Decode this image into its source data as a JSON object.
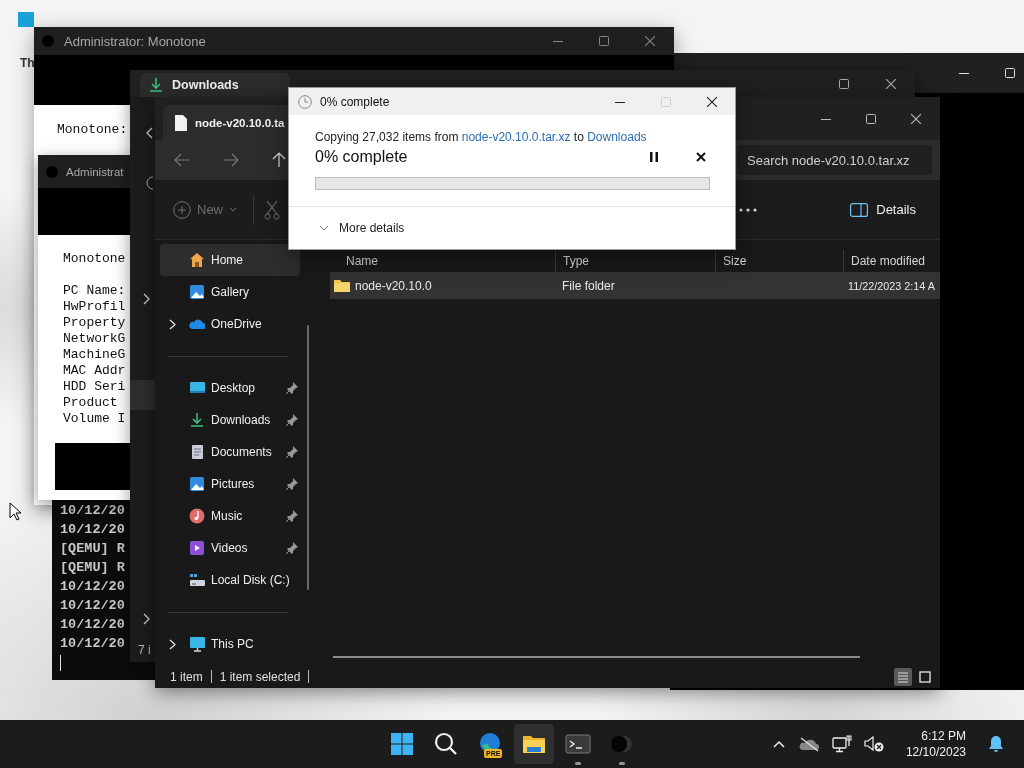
{
  "desktop": {
    "icons": [
      {
        "label": "Th"
      }
    ]
  },
  "console_main": {
    "title": "Administrator: Monotone",
    "lines": [
      "Monotone:"
    ]
  },
  "console_info": {
    "title": "Administrat",
    "header": "Monotone",
    "fields": [
      "PC Name:",
      "HwProfil",
      "Property",
      "NetworkG",
      "MachineG",
      "MAC Addr",
      "HDD Seri",
      "Product",
      "Volume I"
    ]
  },
  "console_log": {
    "lines": [
      "10/12/20",
      "10/12/20",
      "[QEMU] R",
      "[QEMU] R",
      "10/12/20",
      "10/12/20",
      "10/12/20",
      "10/12/20"
    ]
  },
  "explorer_back": {
    "tab": "Downloads",
    "status": "7 i"
  },
  "explorer": {
    "tab": "node-v20.10.0.ta",
    "search_placeholder": "Search node-v20.10.0.tar.xz",
    "toolbar": {
      "new": {
        "label": "New",
        "disabled": true
      },
      "cut": {
        "disabled": true
      },
      "details": {
        "label": "Details"
      }
    },
    "nav_sections": [
      {
        "items": [
          {
            "kind": "home",
            "label": "Home",
            "selected": true,
            "expandable": false,
            "pinned": false
          },
          {
            "kind": "gallery",
            "label": "Gallery",
            "selected": false,
            "expandable": false,
            "pinned": false
          },
          {
            "kind": "onedrive",
            "label": "OneDrive",
            "selected": false,
            "expandable": true,
            "pinned": false
          }
        ]
      },
      {
        "items": [
          {
            "kind": "desktop",
            "label": "Desktop",
            "selected": false,
            "expandable": false,
            "pinned": true
          },
          {
            "kind": "downloads",
            "label": "Downloads",
            "selected": false,
            "expandable": false,
            "pinned": true
          },
          {
            "kind": "documents",
            "label": "Documents",
            "selected": false,
            "expandable": false,
            "pinned": true
          },
          {
            "kind": "pictures",
            "label": "Pictures",
            "selected": false,
            "expandable": false,
            "pinned": true
          },
          {
            "kind": "music",
            "label": "Music",
            "selected": false,
            "expandable": false,
            "pinned": true
          },
          {
            "kind": "videos",
            "label": "Videos",
            "selected": false,
            "expandable": false,
            "pinned": true
          },
          {
            "kind": "disk",
            "label": "Local Disk (C:)",
            "selected": false,
            "expandable": false,
            "pinned": false
          }
        ]
      },
      {
        "items": [
          {
            "kind": "pc",
            "label": "This PC",
            "selected": false,
            "expandable": true,
            "pinned": false
          }
        ]
      }
    ],
    "columns": [
      "Name",
      "Type",
      "Size",
      "Date modified"
    ],
    "rows": [
      {
        "name": "node-v20.10.0",
        "type": "File folder",
        "date": "11/22/2023 2:14 A",
        "selected": true
      }
    ],
    "status": {
      "count": "1 item",
      "selection": "1 item selected"
    },
    "view_buttons": [
      {
        "kind": "details",
        "selected": true
      },
      {
        "kind": "tiles",
        "selected": false
      }
    ]
  },
  "copy_dialog": {
    "title": "0% complete",
    "maximize_disabled": true,
    "message": {
      "before": "Copying 27,032 items from ",
      "source": "node-v20.10.0.tar.xz",
      "between": " to ",
      "destination": "Downloads"
    },
    "heading": "0% complete",
    "progress": {
      "level": 0
    },
    "more_details": "More details"
  },
  "taskbar": {
    "apps": [
      {
        "kind": "start",
        "selected": false,
        "running": false
      },
      {
        "kind": "search",
        "selected": false,
        "running": false
      },
      {
        "kind": "edge",
        "badge": "PRE",
        "selected": false,
        "running": false
      },
      {
        "kind": "explorer",
        "selected": true,
        "running": false
      },
      {
        "kind": "terminal",
        "selected": false,
        "running": true
      },
      {
        "kind": "app",
        "selected": false,
        "running": true
      }
    ],
    "tray": [
      {
        "kind": "chevron"
      },
      {
        "kind": "cloud-off"
      },
      {
        "kind": "network"
      },
      {
        "kind": "volume-muted"
      }
    ],
    "time": "6:12 PM",
    "date": "12/10/2023"
  }
}
